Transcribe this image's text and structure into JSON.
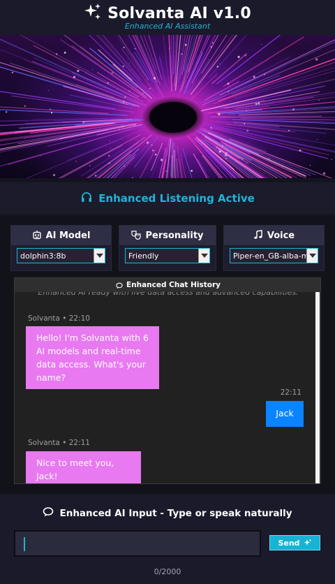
{
  "header": {
    "title": "Solvanta AI v1.0",
    "subtitle": "Enhanced AI Assistant",
    "logo_icon": "sparkle-icon"
  },
  "status": {
    "text": "Enhanced Listening Active",
    "icon": "headphones-icon",
    "color": "#1fb5d6"
  },
  "settings": {
    "model": {
      "label": "AI Model",
      "icon": "robot-icon",
      "value": "dolphin3:8b"
    },
    "personality": {
      "label": "Personality",
      "icon": "theater-masks-icon",
      "value": "Friendly"
    },
    "voice": {
      "label": "Voice",
      "icon": "music-note-icon",
      "value": "Piper-en_GB-alba-m"
    }
  },
  "chat": {
    "title": "Enhanced Chat History",
    "system_message": "Enhanced AI ready with live data access and advanced capabilities.",
    "messages": [
      {
        "role": "ai",
        "meta": "Solvanta • 22:10",
        "text": "Hello! I'm Solvanta with 6 AI models and real-time data access. What's your name?"
      },
      {
        "role": "user",
        "meta": "22:11",
        "text": "Jack"
      },
      {
        "role": "ai",
        "meta": "Solvanta • 22:11",
        "text": "Nice to meet you, Jack!"
      }
    ]
  },
  "input": {
    "title": "Enhanced AI Input - Type or speak naturally",
    "value": "",
    "send_label": "Send",
    "counter": "0/2000"
  },
  "colors": {
    "accent": "#1fb5d6",
    "ai_bubble": "#e879f0",
    "user_bubble": "#0a84ff",
    "background": "#1a1a2b"
  }
}
